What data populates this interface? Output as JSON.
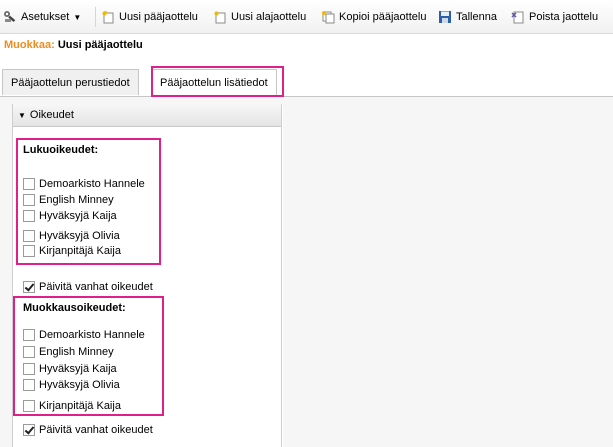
{
  "toolbar": {
    "settings_label": "Asetukset",
    "new_main_label": "Uusi pääjaottelu",
    "new_sub_label": "Uusi alajaottelu",
    "copy_label": "Kopioi pääjaottelu",
    "save_label": "Tallenna",
    "delete_label": "Poista jaottelu"
  },
  "edit": {
    "prefix": "Muokkaa:",
    "name": "Uusi pääjaottelu"
  },
  "tabs": [
    {
      "label": "Pääjaottelun perustiedot",
      "active": false
    },
    {
      "label": "Pääjaottelun lisätiedot",
      "active": true
    }
  ],
  "section": {
    "title": "Oikeudet"
  },
  "read_rights": {
    "title": "Lukuoikeudet:",
    "users": [
      {
        "name": "Demoarkisto Hannele",
        "checked": false
      },
      {
        "name": "English Minney",
        "checked": false
      },
      {
        "name": "Hyväksyjä Kaija",
        "checked": false
      },
      {
        "name": "Hyväksyjä Olivia",
        "checked": false
      },
      {
        "name": "Kirjanpitäjä Kaija",
        "checked": false
      }
    ],
    "update_old": {
      "label": "Päivitä vanhat oikeudet",
      "checked": true
    }
  },
  "edit_rights": {
    "title": "Muokkausoikeudet:",
    "users": [
      {
        "name": "Demoarkisto Hannele",
        "checked": false
      },
      {
        "name": "English Minney",
        "checked": false
      },
      {
        "name": "Hyväksyjä Kaija",
        "checked": false
      },
      {
        "name": "Hyväksyjä Olivia",
        "checked": false
      },
      {
        "name": "Kirjanpitäjä Kaija",
        "checked": false
      }
    ],
    "update_old": {
      "label": "Päivitä vanhat oikeudet",
      "checked": true
    }
  },
  "colors": {
    "highlight": "#e0208a",
    "edit_prefix": "#f08c1c"
  },
  "icons": [
    "settings-icon",
    "new-main-icon",
    "new-sub-icon",
    "copy-icon",
    "save-icon",
    "delete-icon"
  ]
}
